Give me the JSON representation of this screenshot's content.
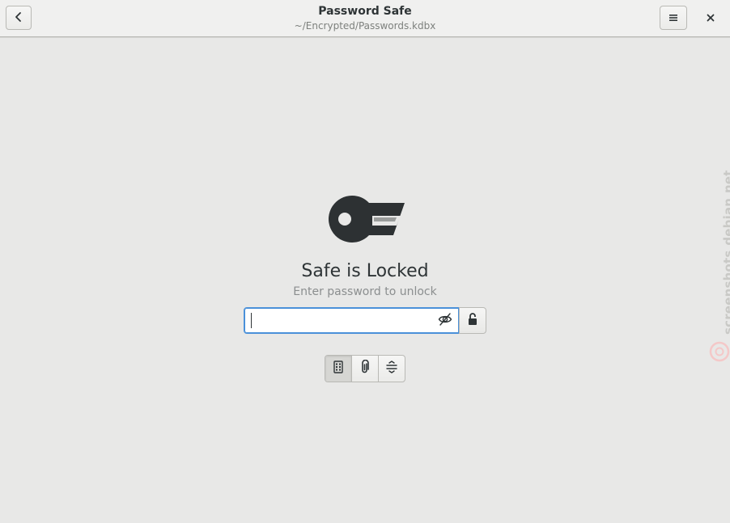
{
  "window": {
    "title": "Password Safe",
    "subtitle": "~/Encrypted/Passwords.kdbx"
  },
  "header": {
    "back_icon": "chevron-left-icon",
    "menu_icon": "hamburger-menu-icon",
    "close_icon": "close-icon"
  },
  "unlock": {
    "heading": "Safe is Locked",
    "hint": "Enter password to unlock",
    "password_value": "",
    "password_placeholder": "",
    "reveal_icon": "eye-hidden-icon",
    "unlock_icon": "lock-icon"
  },
  "modes": [
    {
      "icon": "keypad-icon",
      "active": true
    },
    {
      "icon": "paperclip-icon",
      "active": false
    },
    {
      "icon": "composite-icon",
      "active": false
    }
  ],
  "watermark": {
    "text": "screenshots.debian.net"
  },
  "colors": {
    "accent": "#4a90d9",
    "background": "#e8e8e7",
    "header": "#f0f0ef",
    "text": "#2e3436",
    "dim_text": "#8b8e8f"
  }
}
